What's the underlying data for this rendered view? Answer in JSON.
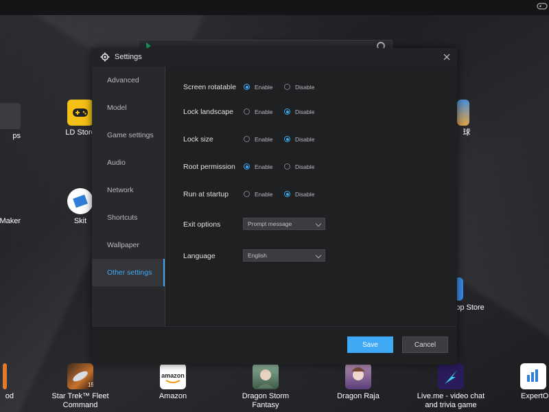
{
  "desktop": {
    "left_apps": [
      {
        "label": "ps"
      },
      {
        "label": "LD Store"
      },
      {
        "label": "Maker"
      },
      {
        "label": "Skit"
      }
    ],
    "right_apps": [
      {
        "label": "球"
      },
      {
        "label": "pp Store"
      }
    ],
    "dock": [
      {
        "label": "od"
      },
      {
        "label": "Star Trek™ Fleet Command"
      },
      {
        "label": "Amazon",
        "icon_text": "amazon"
      },
      {
        "label": "Dragon Storm Fantasy"
      },
      {
        "label": "Dragon Raja"
      },
      {
        "label": "Live.me - video chat and trivia game"
      },
      {
        "label": "ExpertOp"
      }
    ]
  },
  "settings": {
    "title": "Settings",
    "sidebar": [
      {
        "label": "Advanced"
      },
      {
        "label": "Model"
      },
      {
        "label": "Game settings"
      },
      {
        "label": "Audio"
      },
      {
        "label": "Network"
      },
      {
        "label": "Shortcuts"
      },
      {
        "label": "Wallpaper"
      },
      {
        "label": "Other settings",
        "active": true
      }
    ],
    "options": [
      {
        "label": "Screen rotatable",
        "enable": "Enable",
        "disable": "Disable",
        "selected": "enable"
      },
      {
        "label": "Lock landscape",
        "enable": "Enable",
        "disable": "Disable",
        "selected": "disable"
      },
      {
        "label": "Lock size",
        "enable": "Enable",
        "disable": "Disable",
        "selected": "disable"
      },
      {
        "label": "Root permission",
        "enable": "Enable",
        "disable": "Disable",
        "selected": "enable"
      },
      {
        "label": "Run at startup",
        "enable": "Enable",
        "disable": "Disable",
        "selected": "disable"
      }
    ],
    "exit_options": {
      "label": "Exit options",
      "value": "Prompt message"
    },
    "language": {
      "label": "Language",
      "value": "English"
    },
    "save_label": "Save",
    "cancel_label": "Cancel",
    "accent_color": "#3fa9f5"
  }
}
